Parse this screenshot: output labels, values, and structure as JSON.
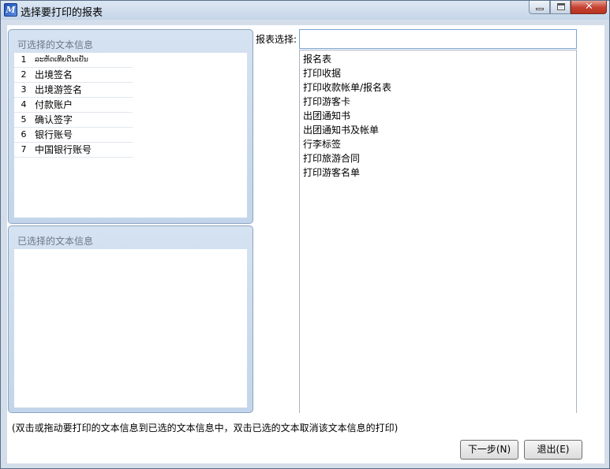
{
  "window": {
    "title": "选择要打印的报表",
    "app_icon_glyph": "M",
    "close_glyph": "✕"
  },
  "available_panel": {
    "caption": "可选择的文本信息",
    "rows": [
      {
        "num": "1",
        "label": "ລະຫັດເທີຍດີນເຢັນ"
      },
      {
        "num": "2",
        "label": "出境签名"
      },
      {
        "num": "3",
        "label": "出境游签名"
      },
      {
        "num": "4",
        "label": "付款账户"
      },
      {
        "num": "5",
        "label": "确认签字"
      },
      {
        "num": "6",
        "label": "银行账号"
      },
      {
        "num": "7",
        "label": "中国银行账号"
      }
    ]
  },
  "selected_panel": {
    "caption": "已选择的文本信息"
  },
  "report": {
    "label": "报表选择:",
    "input_value": "",
    "items": [
      "报名表",
      "打印收据",
      "打印收款帐单/报名表",
      "打印游客卡",
      "出团通知书",
      "出团通知书及帐单",
      "行李标签",
      "打印旅游合同",
      "打印游客名单"
    ]
  },
  "hint": "(双击或拖动要打印的文本信息到已选的文本信息中，双击已选的文本取消该文本信息的打印)",
  "buttons": {
    "next": "下一步(N)",
    "exit": "退出(E)"
  }
}
